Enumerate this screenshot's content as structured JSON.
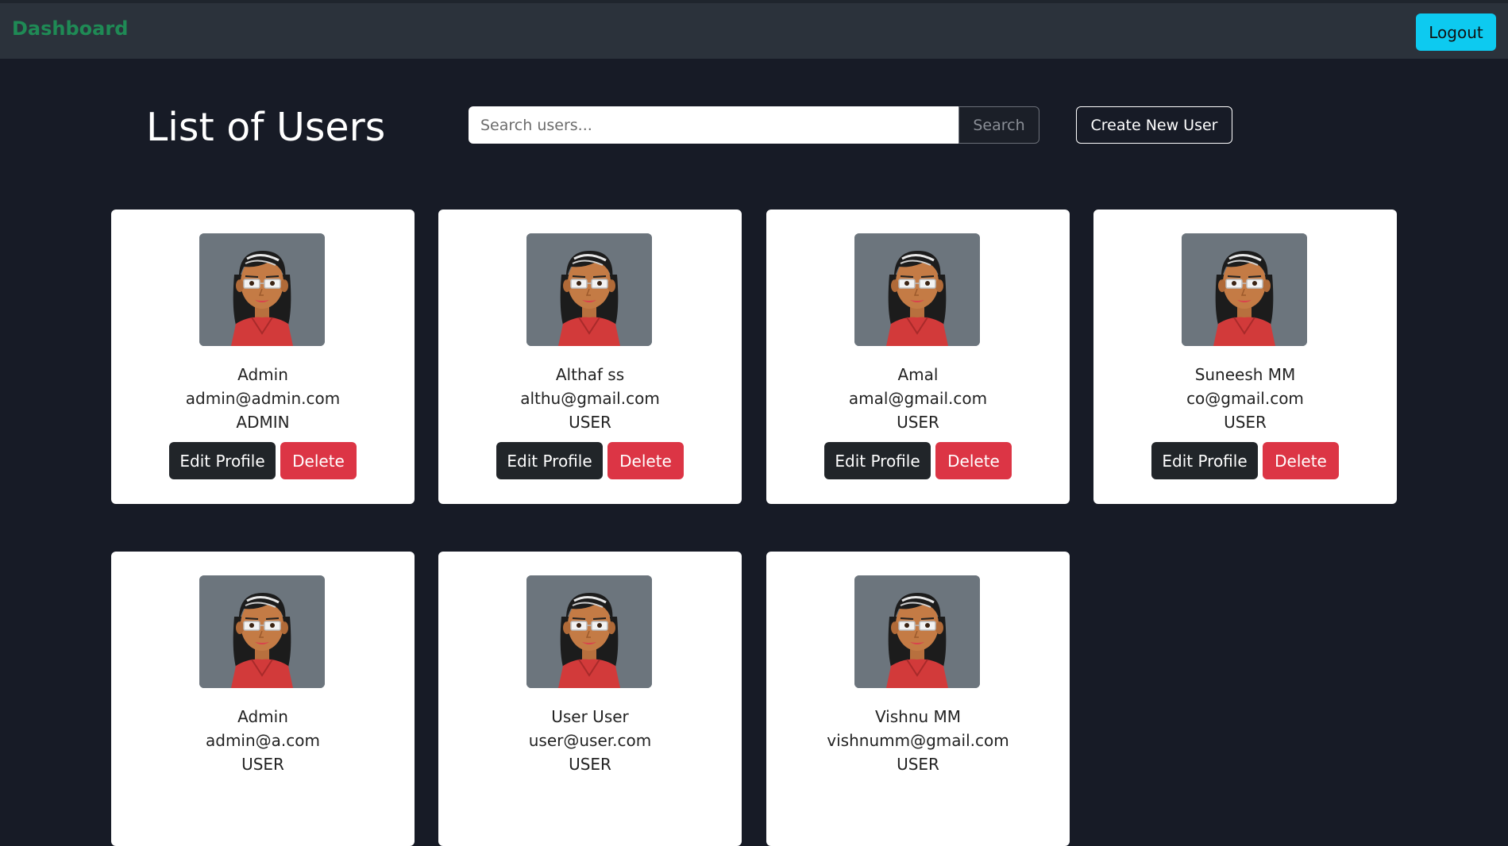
{
  "nav": {
    "brand": "Dashboard",
    "logout_label": "Logout"
  },
  "header": {
    "title": "List of Users",
    "search_placeholder": "Search users...",
    "search_label": "Search",
    "create_label": "Create New User"
  },
  "actions": {
    "edit_label": "Edit Profile",
    "delete_label": "Delete"
  },
  "users": [
    {
      "name": "Admin",
      "email": "admin@admin.com",
      "role": "ADMIN"
    },
    {
      "name": "Althaf ss",
      "email": "althu@gmail.com",
      "role": "USER"
    },
    {
      "name": "Amal",
      "email": "amal@gmail.com",
      "role": "USER"
    },
    {
      "name": "Suneesh MM",
      "email": "co@gmail.com",
      "role": "USER"
    },
    {
      "name": "Admin",
      "email": "admin@a.com",
      "role": "USER"
    },
    {
      "name": "User User",
      "email": "user@user.com",
      "role": "USER"
    },
    {
      "name": "Vishnu MM",
      "email": "vishnumm@gmail.com",
      "role": "USER"
    }
  ],
  "colors": {
    "background": "#171b26",
    "navbar": "#2b323b",
    "brand": "#1f8a55",
    "logout": "#0dcaf0",
    "avatar_bg": "#6c757d",
    "edit": "#212529",
    "delete": "#dc3545"
  },
  "icons": {
    "avatar": "user-avatar-icon"
  }
}
